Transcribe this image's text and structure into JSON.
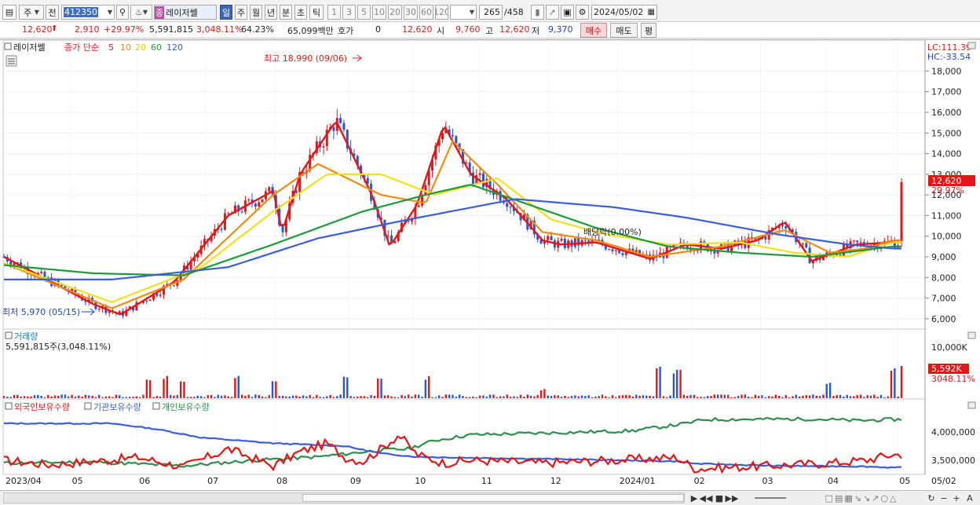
{
  "toolbar": {
    "period_type": "주",
    "prev_label": "전",
    "stock_code": "412350",
    "stock_name_tag": "종",
    "stock_name": "레이저쎌",
    "periods": [
      "일",
      "주",
      "월",
      "년",
      "분",
      "초",
      "틱"
    ],
    "active_period": "일",
    "intervals": [
      "1",
      "3",
      "5",
      "10",
      "20",
      "30",
      "60",
      "120"
    ],
    "count_shown": "265",
    "count_total": "/458",
    "date": "2024/05/02"
  },
  "quote": {
    "price": "12,620",
    "change": "2,910",
    "change_pct": "+29.97%",
    "volume": "5,591,815",
    "volume_ratio": "3,048.11%",
    "turnover_rate": "64.23%",
    "amount": "65,099백만",
    "quote_label": "호가",
    "quote_value": "0",
    "quote_price": "12,620",
    "open_label": "시",
    "open": "9,760",
    "high_label": "고",
    "high": "12,620",
    "low_label": "저",
    "low": "9,370",
    "buy_label": "매수",
    "sell_label": "매도",
    "avg_label": "평"
  },
  "price_panel": {
    "stock_name": "레이저쎌",
    "ma_prefix": "종가 단순",
    "ma_periods": [
      "5",
      "10",
      "20",
      "60",
      "120"
    ],
    "ma_colors": [
      "#e01818",
      "#f08a10",
      "#f0e020",
      "#1e9a3c",
      "#3a5fd8"
    ],
    "high_annotation": "최고 18,990 (09/06)",
    "low_annotation": "최저 5,970 (05/15)",
    "dividend_label": "배당락(0.00%)",
    "lc_label": "LC:111.39",
    "hc_label": "HC:-33.54",
    "current_price_label": "12,620",
    "current_pct_label": "29.97%"
  },
  "volume_panel": {
    "title": "거래량",
    "info": "5,591,815주(3,048.11%)",
    "axis_label": "10,000K",
    "current_label": "5,592K",
    "current_pct": "3048.11%"
  },
  "holding_panel": {
    "foreign_label": "외국인보유수량",
    "inst_label": "기관보유수량",
    "indiv_label": "개인보유수량",
    "axis_labels": [
      "4,000,000",
      "3,500,000"
    ],
    "colors": {
      "foreign": "#e01818",
      "inst": "#3a5fd8",
      "indiv": "#2f8f4e"
    }
  },
  "chart_data": [
    {
      "type": "candlestick",
      "title": "레이저쎌",
      "x_axis": [
        "2023/04",
        "05",
        "06",
        "07",
        "08",
        "09",
        "10",
        "11",
        "12",
        "2024/01",
        "02",
        "03",
        "04",
        "05",
        "05/02"
      ],
      "y_ticks": [
        6000,
        7000,
        8000,
        9000,
        10000,
        11000,
        12000,
        13000,
        14000,
        15000,
        16000,
        17000,
        18000
      ],
      "ylim": [
        5500,
        19500
      ],
      "series": [
        {
          "name": "5",
          "approx_points": [
            [
              0,
              9000
            ],
            [
              0.1,
              6700
            ],
            [
              0.13,
              6200
            ],
            [
              0.19,
              7800
            ],
            [
              0.25,
              11000
            ],
            [
              0.3,
              12200
            ],
            [
              0.31,
              10200
            ],
            [
              0.33,
              13000
            ],
            [
              0.37,
              15600
            ],
            [
              0.41,
              12000
            ],
            [
              0.43,
              9500
            ],
            [
              0.46,
              11500
            ],
            [
              0.49,
              15400
            ],
            [
              0.52,
              13000
            ],
            [
              0.56,
              11800
            ],
            [
              0.6,
              9800
            ],
            [
              0.62,
              9600
            ],
            [
              0.66,
              9700
            ],
            [
              0.72,
              8900
            ],
            [
              0.76,
              9600
            ],
            [
              0.8,
              9400
            ],
            [
              0.84,
              9800
            ],
            [
              0.87,
              10700
            ],
            [
              0.9,
              8800
            ],
            [
              0.95,
              9600
            ],
            [
              0.99,
              9700
            ]
          ]
        },
        {
          "name": "10",
          "approx_points": [
            [
              0,
              8700
            ],
            [
              0.12,
              6500
            ],
            [
              0.2,
              7900
            ],
            [
              0.3,
              12000
            ],
            [
              0.35,
              13500
            ],
            [
              0.42,
              12000
            ],
            [
              0.47,
              11600
            ],
            [
              0.5,
              14600
            ],
            [
              0.55,
              12500
            ],
            [
              0.6,
              10200
            ],
            [
              0.66,
              9800
            ],
            [
              0.72,
              9000
            ],
            [
              0.8,
              9500
            ],
            [
              0.87,
              10300
            ],
            [
              0.92,
              9200
            ],
            [
              0.96,
              9400
            ],
            [
              0.99,
              9800
            ]
          ]
        },
        {
          "name": "20",
          "approx_points": [
            [
              0,
              8700
            ],
            [
              0.12,
              6800
            ],
            [
              0.22,
              8500
            ],
            [
              0.3,
              11200
            ],
            [
              0.36,
              13000
            ],
            [
              0.42,
              13000
            ],
            [
              0.48,
              12000
            ],
            [
              0.55,
              12800
            ],
            [
              0.61,
              10800
            ],
            [
              0.67,
              10100
            ],
            [
              0.74,
              9600
            ],
            [
              0.82,
              9700
            ],
            [
              0.88,
              9200
            ],
            [
              0.94,
              9000
            ],
            [
              0.99,
              9700
            ]
          ]
        },
        {
          "name": "60",
          "approx_points": [
            [
              0,
              8600
            ],
            [
              0.1,
              8200
            ],
            [
              0.2,
              8100
            ],
            [
              0.3,
              9600
            ],
            [
              0.4,
              11200
            ],
            [
              0.47,
              12000
            ],
            [
              0.52,
              12500
            ],
            [
              0.58,
              11600
            ],
            [
              0.66,
              10400
            ],
            [
              0.74,
              9500
            ],
            [
              0.82,
              9200
            ],
            [
              0.9,
              9000
            ],
            [
              0.99,
              9500
            ]
          ]
        },
        {
          "name": "120",
          "approx_points": [
            [
              0,
              7900
            ],
            [
              0.12,
              7900
            ],
            [
              0.25,
              8500
            ],
            [
              0.35,
              9900
            ],
            [
              0.45,
              10800
            ],
            [
              0.57,
              11800
            ],
            [
              0.68,
              11400
            ],
            [
              0.76,
              10900
            ],
            [
              0.86,
              10100
            ],
            [
              0.94,
              9600
            ],
            [
              0.99,
              9400
            ]
          ]
        }
      ]
    },
    {
      "type": "bar",
      "title": "거래량",
      "ylim": [
        0,
        12000
      ],
      "units": "K",
      "approx_peaks": [
        [
          0.16,
          3500
        ],
        [
          0.18,
          4200
        ],
        [
          0.2,
          3400
        ],
        [
          0.26,
          4000
        ],
        [
          0.3,
          3500
        ],
        [
          0.38,
          4500
        ],
        [
          0.42,
          3600
        ],
        [
          0.47,
          3900
        ],
        [
          0.6,
          1600
        ],
        [
          0.73,
          6000
        ],
        [
          0.75,
          5000
        ],
        [
          0.92,
          2800
        ],
        [
          0.99,
          5592
        ]
      ]
    },
    {
      "type": "line",
      "title": "보유수량",
      "y_ticks": [
        4000000,
        3500000
      ],
      "series": [
        {
          "name": "외국인보유수량",
          "approx_shape": "oscillating 3.3M-3.9M, spike near 09, settles ~3.3M after 02, rises to ~3.6M at end"
        },
        {
          "name": "기관보유수량",
          "approx_shape": "~4.15M flat, steps down through 06-08 to ~3.55M by 10, ~3.45M after 02"
        },
        {
          "name": "개인보유수량",
          "approx_shape": "~3.45M through 09, steps up to ~3.95M by 10, ~4.2M after 02"
        }
      ]
    }
  ]
}
